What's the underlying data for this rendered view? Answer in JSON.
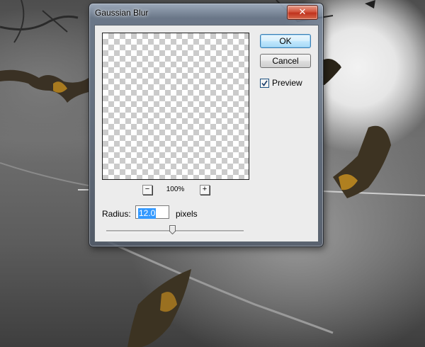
{
  "dialog": {
    "title": "Gaussian Blur",
    "close_symbol": "✕"
  },
  "preview": {
    "zoom_out_symbol": "−",
    "zoom_in_symbol": "+",
    "zoom_level": "100%"
  },
  "buttons": {
    "ok_label": "OK",
    "cancel_label": "Cancel"
  },
  "preview_option": {
    "label": "Preview",
    "checked": true
  },
  "radius": {
    "label": "Radius:",
    "value": "12.0",
    "unit": "pixels",
    "slider_fraction": 0.48
  },
  "colors": {
    "ok_accent": "#3c7fb1",
    "close_red": "#c0321d",
    "selection_blue": "#3399ff"
  }
}
